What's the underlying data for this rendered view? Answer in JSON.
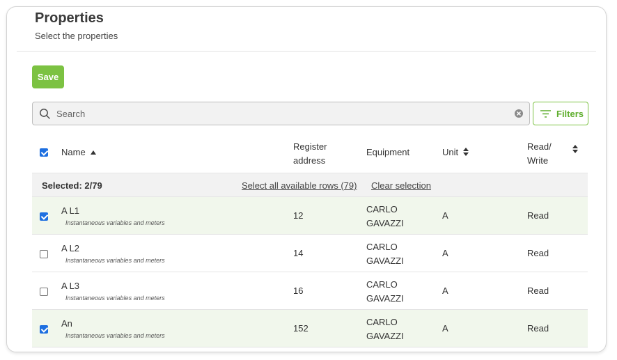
{
  "header": {
    "title": "Properties",
    "subtitle": "Select the properties"
  },
  "toolbar": {
    "save_label": "Save"
  },
  "search": {
    "placeholder": "Search",
    "value": ""
  },
  "filters": {
    "label": "Filters"
  },
  "table": {
    "columns": {
      "name": "Name",
      "register_line1": "Register",
      "register_line2": "address",
      "equipment": "Equipment",
      "unit": "Unit",
      "rw_line1": "Read/",
      "rw_line2": "Write"
    },
    "select_all_checked": true,
    "selection": {
      "count_text": "Selected: 2/79",
      "select_all_text": "Select all available rows (79)",
      "clear_text": "Clear selection"
    },
    "rows": [
      {
        "name": "A L1",
        "description": "Instantaneous variables and meters",
        "register": "12",
        "equipment_line1": "CARLO",
        "equipment_line2": "GAVAZZI",
        "unit": "A",
        "rw": "Read",
        "checked": true
      },
      {
        "name": "A L2",
        "description": "Instantaneous variables and meters",
        "register": "14",
        "equipment_line1": "CARLO",
        "equipment_line2": "GAVAZZI",
        "unit": "A",
        "rw": "Read",
        "checked": false
      },
      {
        "name": "A L3",
        "description": "Instantaneous variables and meters",
        "register": "16",
        "equipment_line1": "CARLO",
        "equipment_line2": "GAVAZZI",
        "unit": "A",
        "rw": "Read",
        "checked": false
      },
      {
        "name": "An",
        "description": "Instantaneous variables and meters",
        "register": "152",
        "equipment_line1": "CARLO",
        "equipment_line2": "GAVAZZI",
        "unit": "A",
        "rw": "Read",
        "checked": true
      }
    ]
  },
  "colors": {
    "accent_green": "#7cc242",
    "selected_row_bg": "#f1f7ec",
    "checkbox_blue": "#1d6fe0"
  },
  "icons": {
    "search": "search-icon",
    "clear": "clear-circle-icon",
    "filter": "filter-lines-icon",
    "sort_asc": "caret-up-icon",
    "sort_both": "sort-updown-icon"
  }
}
